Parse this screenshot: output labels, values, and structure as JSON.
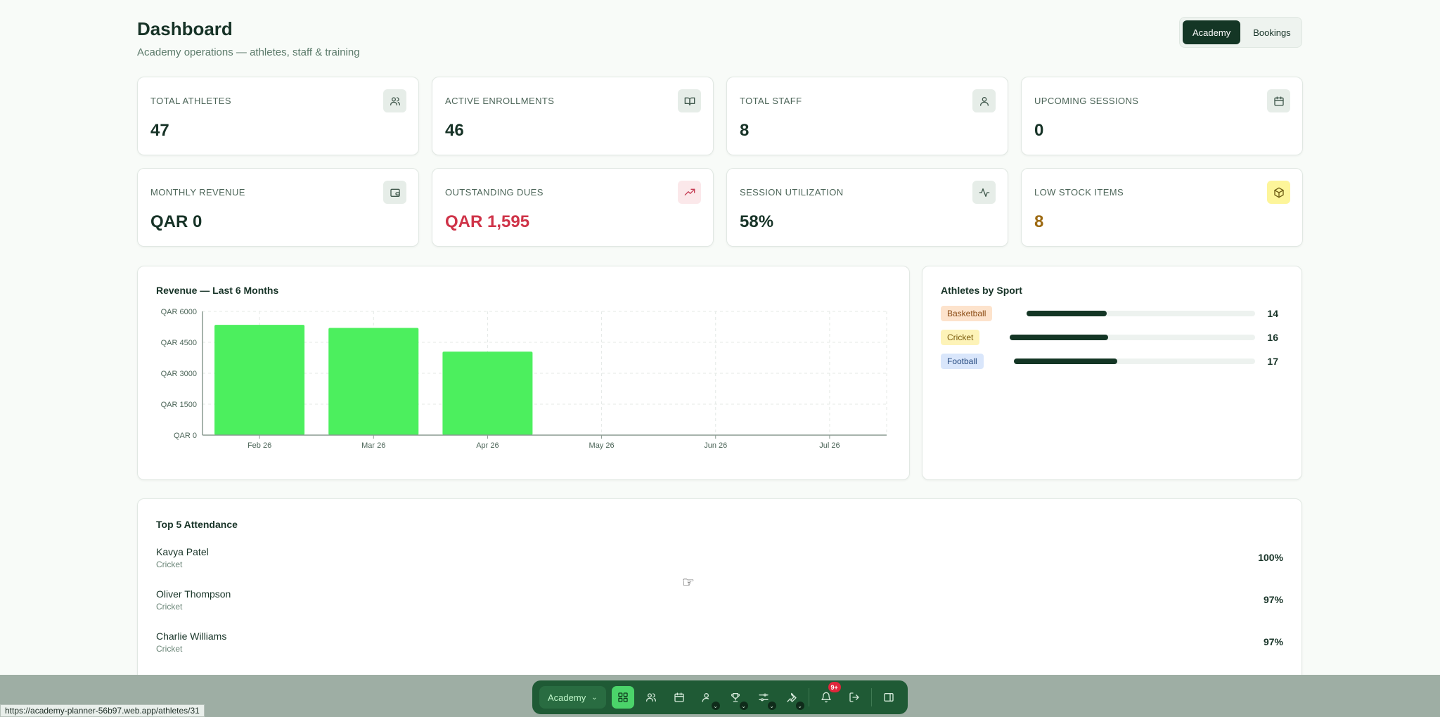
{
  "header": {
    "title": "Dashboard",
    "subtitle": "Academy operations — athletes, staff & training",
    "modes": [
      "Academy",
      "Bookings"
    ],
    "active_mode": "Academy"
  },
  "stats": [
    {
      "label": "TOTAL ATHLETES",
      "value": "47",
      "icon": "users-icon"
    },
    {
      "label": "ACTIVE ENROLLMENTS",
      "value": "46",
      "icon": "book-open-icon"
    },
    {
      "label": "TOTAL STAFF",
      "value": "8",
      "icon": "user-icon"
    },
    {
      "label": "UPCOMING SESSIONS",
      "value": "0",
      "icon": "calendar-icon"
    },
    {
      "label": "MONTHLY REVENUE",
      "value": "QAR 0",
      "icon": "wallet-icon"
    },
    {
      "label": "OUTSTANDING DUES",
      "value": "QAR 1,595",
      "icon": "trending-up-icon",
      "value_color": "#cf3348"
    },
    {
      "label": "SESSION UTILIZATION",
      "value": "58%",
      "icon": "activity-icon"
    },
    {
      "label": "LOW STOCK ITEMS",
      "value": "8",
      "icon": "package-icon",
      "value_color": "#9d6a12"
    }
  ],
  "chart_data": {
    "type": "bar",
    "title": "Revenue — Last 6 Months",
    "categories": [
      "Feb 26",
      "Mar 26",
      "Apr 26",
      "May 26",
      "Jun 26",
      "Jul 26"
    ],
    "values": [
      5350,
      5200,
      4050,
      0,
      0,
      0
    ],
    "ylim": [
      0,
      6000
    ],
    "yticks": [
      "QAR 0",
      "QAR 1500",
      "QAR 3000",
      "QAR 4500",
      "QAR 6000"
    ],
    "ytick_values": [
      0,
      1500,
      3000,
      4500,
      6000
    ],
    "bar_color": "#4cef5e",
    "grid": true
  },
  "sports": {
    "title": "Athletes by Sport",
    "items": [
      {
        "name": "Basketball",
        "count": "14",
        "value": 14,
        "badge_bg": "#fde3cc",
        "badge_fg": "#8a4a12"
      },
      {
        "name": "Cricket",
        "count": "16",
        "value": 16,
        "badge_bg": "#fdf3b8",
        "badge_fg": "#7a5a0a"
      },
      {
        "name": "Football",
        "count": "17",
        "value": 17,
        "badge_bg": "#d9e6fb",
        "badge_fg": "#23487e"
      }
    ]
  },
  "attendance": {
    "title": "Top 5 Attendance",
    "items": [
      {
        "name": "Kavya Patel",
        "sport": "Cricket",
        "pct": "100%"
      },
      {
        "name": "Oliver Thompson",
        "sport": "Cricket",
        "pct": "97%"
      },
      {
        "name": "Charlie Williams",
        "sport": "Cricket",
        "pct": "97%"
      }
    ]
  },
  "dock": {
    "academy_label": "Academy",
    "notification_badge": "9+"
  },
  "status_url": "https://academy-planner-56b97.web.app/athletes/31"
}
